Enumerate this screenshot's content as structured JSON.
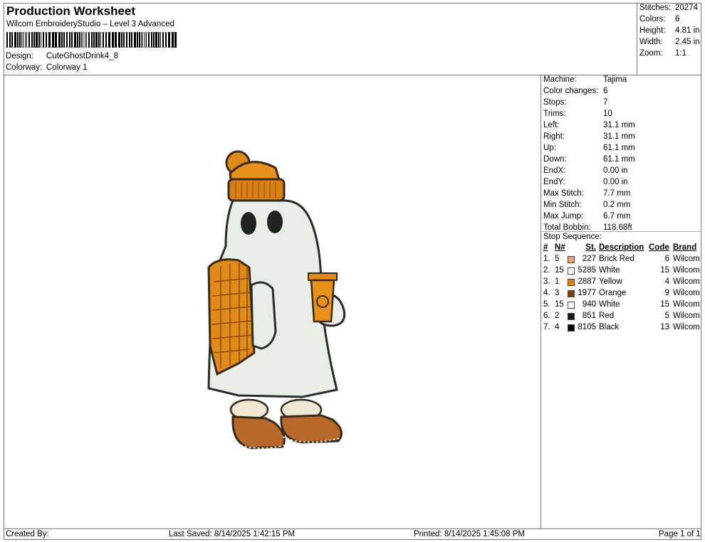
{
  "header": {
    "title": "Production Worksheet",
    "subtitle": "Wilcom EmbroideryStudio – Level 3 Advanced",
    "design_label": "Design:",
    "design_value": "CuteGhostDrink4_8",
    "colorway_label": "Colorway:",
    "colorway_value": "Colorway 1"
  },
  "stats": [
    {
      "label": "Stitches:",
      "value": "20274"
    },
    {
      "label": "Colors:",
      "value": "6"
    },
    {
      "label": "Height:",
      "value": "4.81 in"
    },
    {
      "label": "Width:",
      "value": "2.45 in"
    },
    {
      "label": "Zoom:",
      "value": "1:1"
    }
  ],
  "machine_info": [
    {
      "label": "Machine:",
      "value": "Tajima"
    },
    {
      "label": "Color changes:",
      "value": "6"
    },
    {
      "label": "Stops:",
      "value": "7"
    },
    {
      "label": "Trims:",
      "value": "10"
    },
    {
      "label": "Left:",
      "value": "31.1 mm"
    },
    {
      "label": "Right:",
      "value": "31.1 mm"
    },
    {
      "label": "Up:",
      "value": "61.1 mm"
    },
    {
      "label": "Down:",
      "value": "61.1 mm"
    },
    {
      "label": "EndX:",
      "value": "0.00 in"
    },
    {
      "label": "EndY:",
      "value": "0.00 in"
    },
    {
      "label": "Max Stitch:",
      "value": "7.7 mm"
    },
    {
      "label": "Min Stitch:",
      "value": "0.2 mm"
    },
    {
      "label": "Max Jump:",
      "value": "6.7 mm"
    },
    {
      "label": "Total Bobbin:",
      "value": "118.68ft"
    }
  ],
  "stop_sequence": {
    "title": "Stop Sequence:",
    "headers": {
      "num": "#",
      "n": "N#",
      "st": "St.",
      "desc": "Description",
      "code": "Code",
      "brand": "Brand"
    },
    "rows": [
      {
        "num": "1.",
        "n": "5",
        "color": "#f0a070",
        "st": "227",
        "desc": "Brick Red",
        "code": "6",
        "brand": "Wilcom"
      },
      {
        "num": "2.",
        "n": "15",
        "color": "#ffffff",
        "st": "5285",
        "desc": "White",
        "code": "15",
        "brand": "Wilcom"
      },
      {
        "num": "3.",
        "n": "1",
        "color": "#e8800c",
        "st": "2887",
        "desc": "Yellow",
        "code": "4",
        "brand": "Wilcom"
      },
      {
        "num": "4.",
        "n": "3",
        "color": "#8a3c10",
        "st": "1977",
        "desc": "Orange",
        "code": "9",
        "brand": "Wilcom"
      },
      {
        "num": "5.",
        "n": "15",
        "color": "#ffffff",
        "st": "940",
        "desc": "White",
        "code": "15",
        "brand": "Wilcom"
      },
      {
        "num": "6.",
        "n": "2",
        "color": "#1a1a1a",
        "st": "851",
        "desc": "Red",
        "code": "5",
        "brand": "Wilcom"
      },
      {
        "num": "7.",
        "n": "4",
        "color": "#000000",
        "st": "8105",
        "desc": "Black",
        "code": "13",
        "brand": "Wilcom"
      }
    ]
  },
  "footer": {
    "created": "Created By:",
    "saved": "Last Saved: 8/14/2025 1:42:15 PM",
    "printed": "Printed: 8/14/2025 1:45:08 PM",
    "page": "Page 1 of 1"
  }
}
